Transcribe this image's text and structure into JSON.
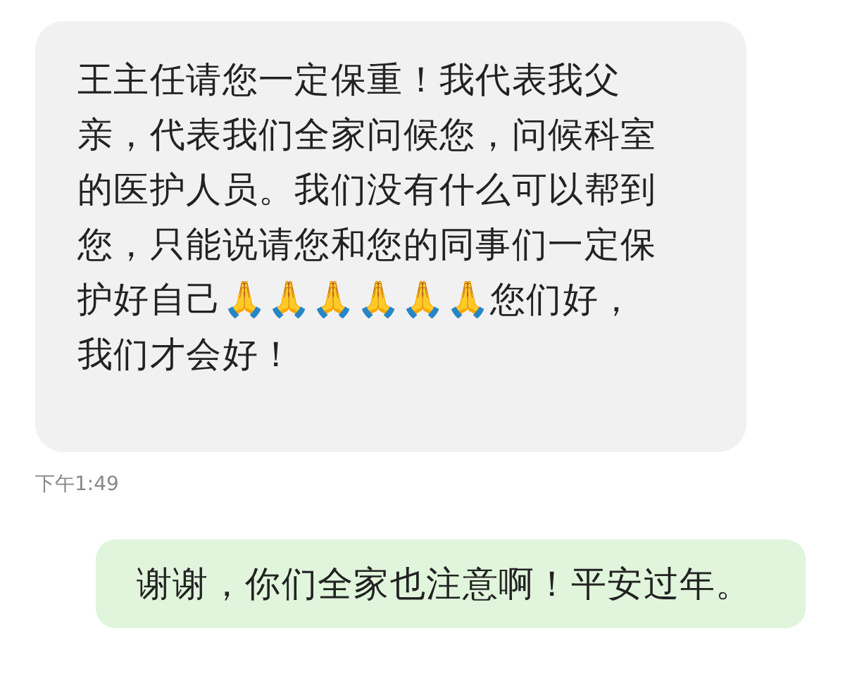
{
  "messages": [
    {
      "kind": "incoming",
      "text": "王主任请您一定保重！我代表我父亲，代表我们全家问候您，问候科室的医护人员。我们没有什么可以帮到您，只能说请您和您的同事们一定保护好自己🙏🙏🙏🙏🙏🙏您们好，我们才会好！",
      "time": "下午1:49"
    },
    {
      "kind": "outgoing",
      "text": "谢谢，你们全家也注意啊！平安过年。"
    }
  ]
}
